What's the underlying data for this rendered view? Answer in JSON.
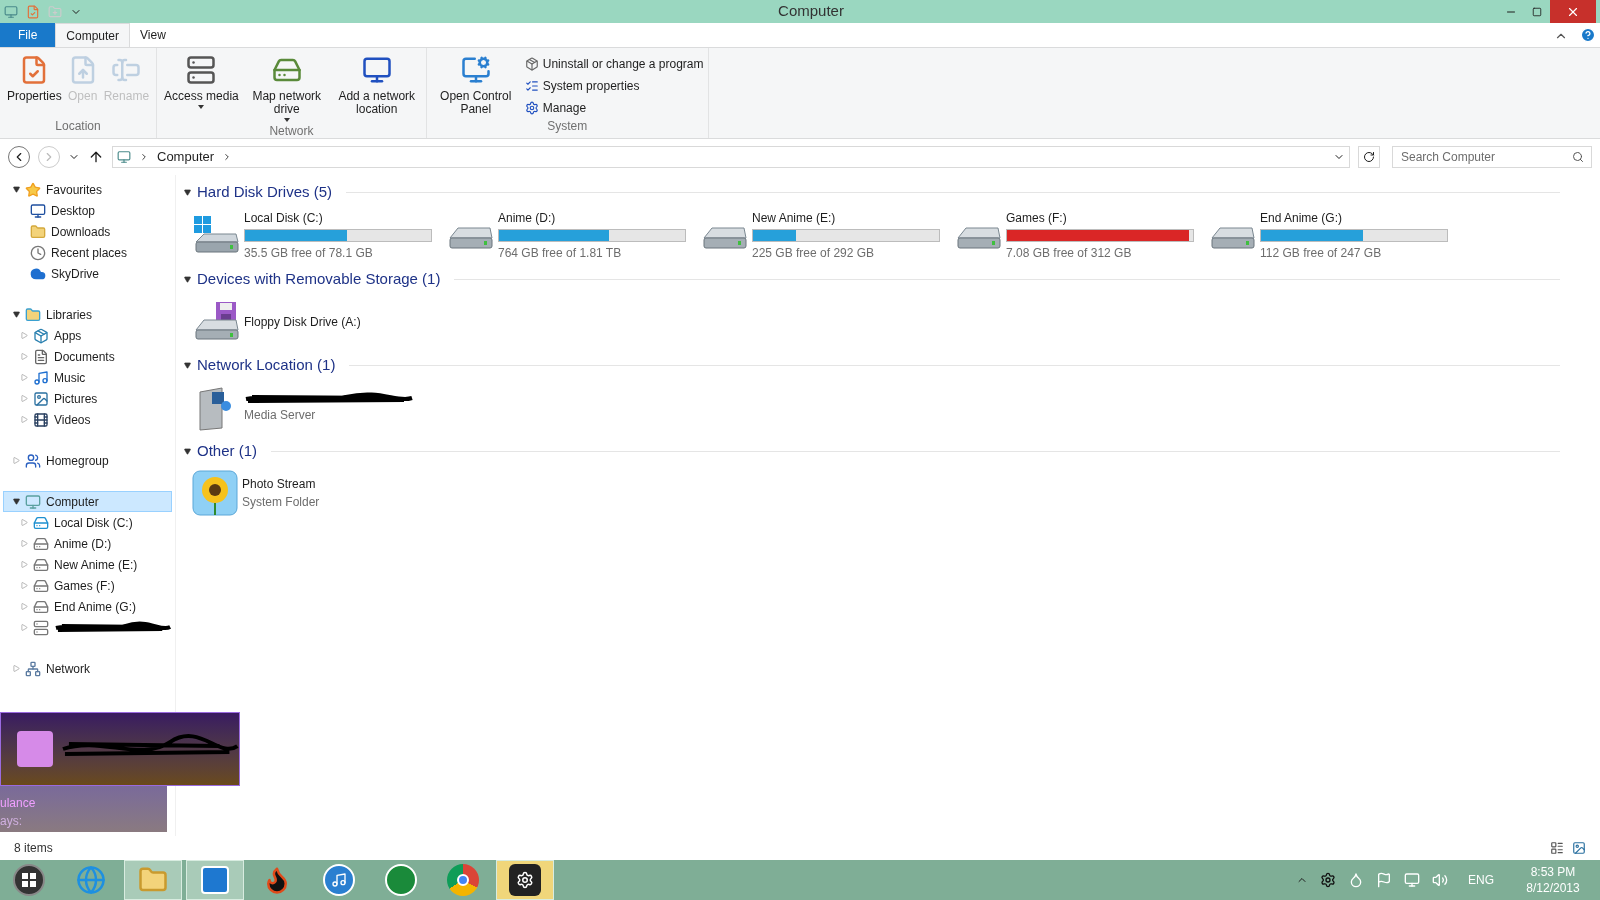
{
  "window": {
    "title": "Computer"
  },
  "ribbon_tabs": [
    {
      "label": "File",
      "kind": "file",
      "selected": false
    },
    {
      "label": "Computer",
      "kind": "tab",
      "selected": true
    },
    {
      "label": "View",
      "kind": "tab",
      "selected": false
    }
  ],
  "ribbon_groups": [
    {
      "label": "Location",
      "items": [
        {
          "kind": "large",
          "label": "Properties",
          "disabled": false
        },
        {
          "kind": "large",
          "label": "Open",
          "disabled": true
        },
        {
          "kind": "large",
          "label": "Rename",
          "disabled": true
        }
      ]
    },
    {
      "label": "Network",
      "items": [
        {
          "kind": "large",
          "label": "Access media",
          "disabled": false,
          "dropdown": true
        },
        {
          "kind": "large",
          "label": "Map network drive",
          "disabled": false,
          "dropdown": true
        },
        {
          "kind": "large",
          "label": "Add a network location",
          "disabled": false,
          "dropdown": false
        }
      ]
    },
    {
      "label": "System",
      "items": [
        {
          "kind": "large",
          "label": "Open Control Panel",
          "disabled": false
        },
        {
          "kind": "small",
          "label": "Uninstall or change a program",
          "disabled": false
        },
        {
          "kind": "small",
          "label": "System properties",
          "disabled": false
        },
        {
          "kind": "small",
          "label": "Manage",
          "disabled": false
        }
      ]
    }
  ],
  "address_bar": {
    "path": [
      "Computer"
    ],
    "search_placeholder": "Search Computer"
  },
  "sidebar": [
    {
      "label": "Favourites",
      "expanded": true,
      "selected": false,
      "children": [
        {
          "label": "Desktop",
          "selected": false
        },
        {
          "label": "Downloads",
          "selected": false
        },
        {
          "label": "Recent places",
          "selected": false
        },
        {
          "label": "SkyDrive",
          "selected": false
        }
      ]
    },
    {
      "label": "Libraries",
      "expanded": true,
      "selected": false,
      "children": [
        {
          "label": "Apps",
          "selected": false
        },
        {
          "label": "Documents",
          "selected": false
        },
        {
          "label": "Music",
          "selected": false
        },
        {
          "label": "Pictures",
          "selected": false
        },
        {
          "label": "Videos",
          "selected": false
        }
      ]
    },
    {
      "label": "Homegroup",
      "expanded": false,
      "selected": false
    },
    {
      "label": "Computer",
      "expanded": true,
      "selected": true,
      "children": [
        {
          "label": "Local Disk (C:)",
          "selected": false
        },
        {
          "label": "Anime (D:)",
          "selected": false
        },
        {
          "label": "New Anime (E:)",
          "selected": false
        },
        {
          "label": "Games (F:)",
          "selected": false
        },
        {
          "label": "End Anime (G:)",
          "selected": false
        },
        {
          "redacted": true,
          "selected": false
        }
      ]
    },
    {
      "label": "Network",
      "expanded": false,
      "selected": false
    }
  ],
  "groups": [
    {
      "title": "Hard Disk Drives (5)",
      "expanded": true,
      "items": [
        {
          "kind": "drive",
          "name": "Local Disk (C:)",
          "detail": "35.5 GB free of 78.1 GB",
          "level": 0.55,
          "low_space": false
        },
        {
          "kind": "drive",
          "name": "Anime (D:)",
          "detail": "764 GB free of 1.81 TB",
          "level": 0.59,
          "low_space": false
        },
        {
          "kind": "drive",
          "name": "New Anime (E:)",
          "detail": "225 GB free of 292 GB",
          "level": 0.23,
          "low_space": false
        },
        {
          "kind": "drive",
          "name": "Games (F:)",
          "detail": "7.08 GB free of 312 GB",
          "level": 0.98,
          "low_space": true
        },
        {
          "kind": "drive",
          "name": "End Anime (G:)",
          "detail": "112 GB free of 247 GB",
          "level": 0.55,
          "low_space": false
        }
      ]
    },
    {
      "title": "Devices with Removable Storage (1)",
      "expanded": true,
      "items": [
        {
          "kind": "device",
          "name": "Floppy Disk Drive (A:)"
        }
      ]
    },
    {
      "title": "Network Location (1)",
      "expanded": true,
      "items": [
        {
          "kind": "folder",
          "redacted": true,
          "detail": "Media Server"
        }
      ]
    },
    {
      "title": "Other (1)",
      "expanded": true,
      "items": [
        {
          "kind": "folder",
          "name": "Photo Stream",
          "redacted": false,
          "detail": "System Folder"
        }
      ]
    }
  ],
  "status_bar": {
    "text": "8 items"
  },
  "notifications": [
    {
      "redacted": true
    },
    {
      "redacted": false,
      "lines": [
        "ulance",
        "ays:"
      ]
    }
  ],
  "taskbar": [
    {
      "kind": "start",
      "running": false,
      "flashing": false
    },
    {
      "kind": "ie",
      "running": false,
      "flashing": false
    },
    {
      "kind": "explorer",
      "running": true,
      "flashing": false
    },
    {
      "kind": "maxthon",
      "running": true,
      "flashing": false
    },
    {
      "kind": "fire",
      "running": false,
      "flashing": false
    },
    {
      "kind": "itunes",
      "running": false,
      "flashing": false
    },
    {
      "kind": "utorrent",
      "running": false,
      "flashing": false
    },
    {
      "kind": "chrome",
      "running": false,
      "flashing": false
    },
    {
      "kind": "steam",
      "running": true,
      "flashing": true
    }
  ],
  "tray": {
    "language": "ENG",
    "time": "8:53 PM",
    "date": "8/12/2013"
  }
}
